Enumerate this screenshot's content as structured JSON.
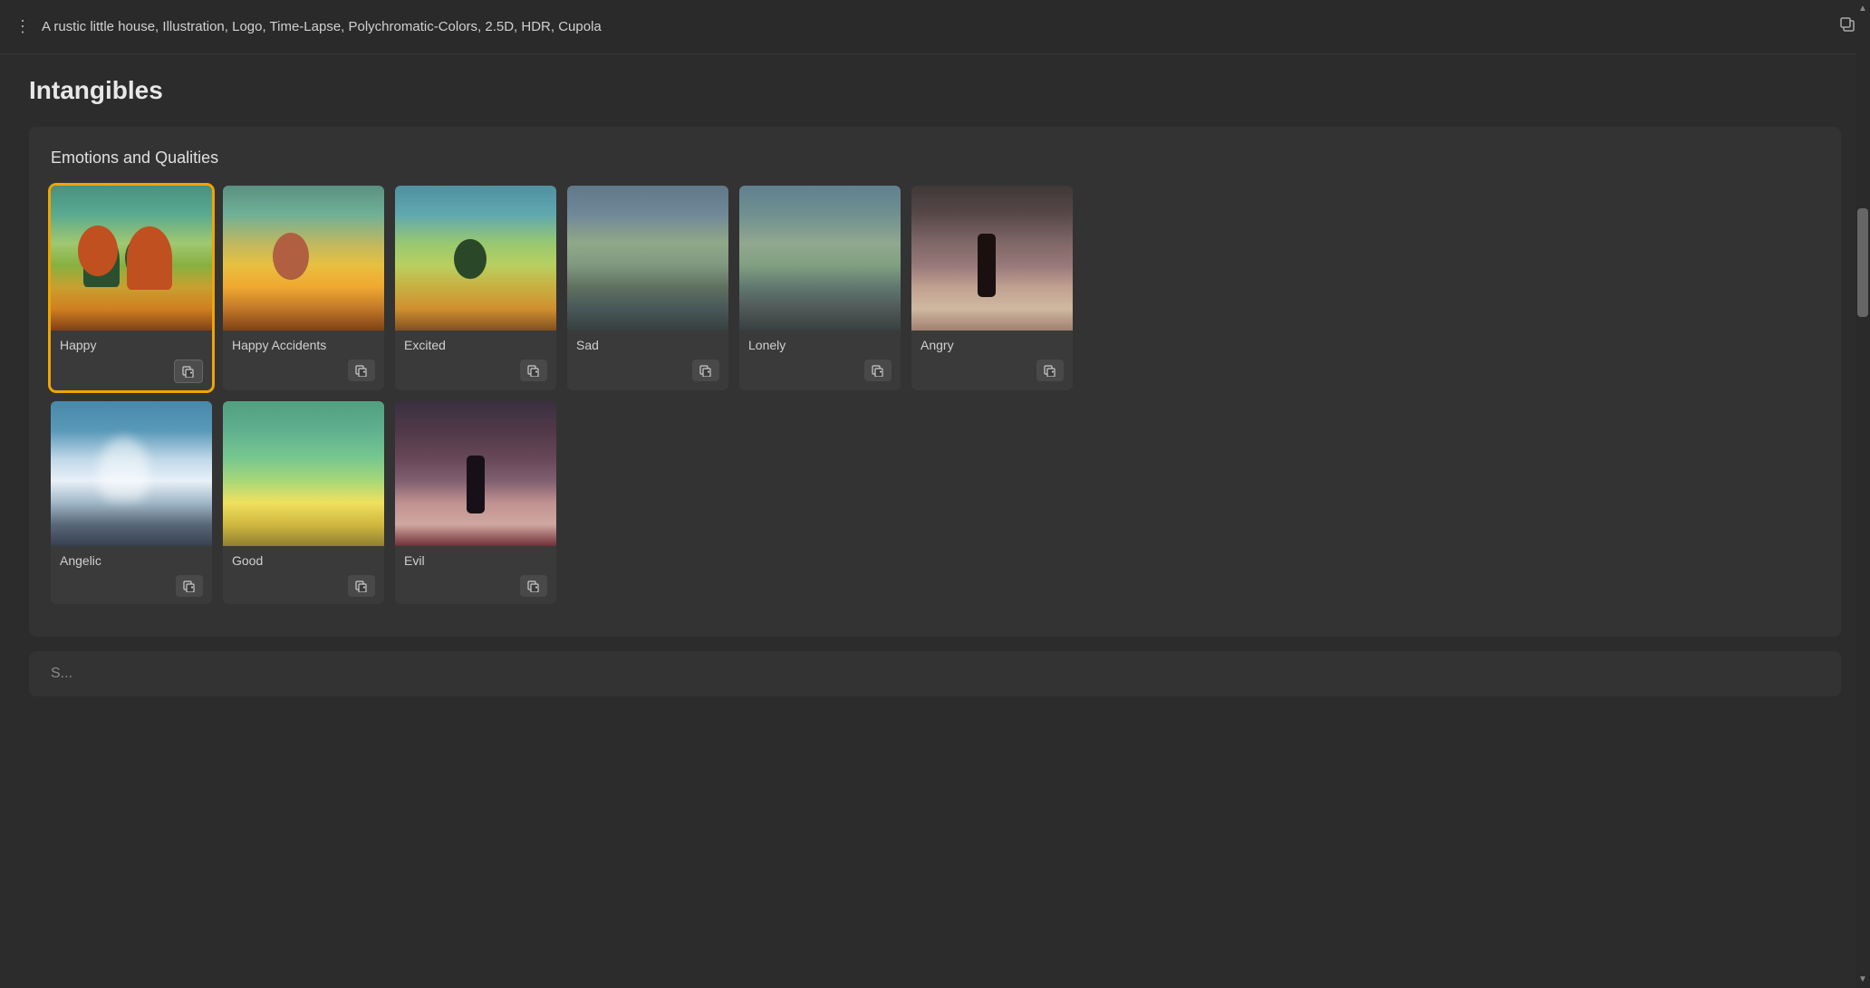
{
  "titleBar": {
    "menuLabel": "⋮",
    "title": "A rustic little house, Illustration, Logo, Time-Lapse, Polychromatic-Colors, 2.5D, HDR, Cupola",
    "copyIcon": "copy"
  },
  "page": {
    "title": "Intangibles",
    "section": {
      "title": "Emotions and Qualities",
      "cards": [
        {
          "id": "happy",
          "label": "Happy",
          "imgClass": "card-img-happy",
          "highlighted": true
        },
        {
          "id": "happy-accidents",
          "label": "Happy Accidents",
          "imgClass": "card-img-happy-accidents",
          "highlighted": false
        },
        {
          "id": "excited",
          "label": "Excited",
          "imgClass": "card-img-excited",
          "highlighted": false
        },
        {
          "id": "sad",
          "label": "Sad",
          "imgClass": "card-img-sad",
          "highlighted": false
        },
        {
          "id": "lonely",
          "label": "Lonely",
          "imgClass": "card-img-lonely",
          "highlighted": false
        },
        {
          "id": "angry",
          "label": "Angry",
          "imgClass": "card-img-angry",
          "highlighted": false
        },
        {
          "id": "angelic",
          "label": "Angelic",
          "imgClass": "card-img-angelic",
          "highlighted": false
        },
        {
          "id": "good",
          "label": "Good",
          "imgClass": "card-img-good",
          "highlighted": false
        },
        {
          "id": "evil",
          "label": "Evil",
          "imgClass": "card-img-evil",
          "highlighted": false
        }
      ]
    }
  },
  "icons": {
    "addToPrompt": "🫙+",
    "menu": "⋮",
    "copy": "❐"
  }
}
